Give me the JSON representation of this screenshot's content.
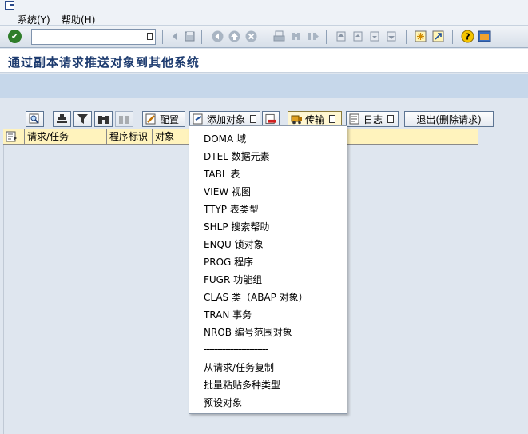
{
  "menubar": {
    "items": [
      {
        "label": "系统(Y)"
      },
      {
        "label": "帮助(H)"
      }
    ]
  },
  "toolbar": {
    "command_value": ""
  },
  "title": "通过副本请求推送对象到其他系统",
  "tree_toolbar": {
    "config_label": "配置",
    "add_object_label": "添加对象",
    "transport_label": "传输",
    "log_label": "日志",
    "exit_label": "退出(删除请求)"
  },
  "columns": [
    {
      "label": "请求/任务"
    },
    {
      "label": "程序标识"
    },
    {
      "label": "对象"
    }
  ],
  "dropdown": {
    "items": [
      {
        "label": "DOMA 域"
      },
      {
        "label": "DTEL 数据元素"
      },
      {
        "label": "TABL 表"
      },
      {
        "label": "VIEW 视图"
      },
      {
        "label": "TTYP 表类型"
      },
      {
        "label": "SHLP 搜索帮助"
      },
      {
        "label": "ENQU 锁对象"
      },
      {
        "label": "PROG 程序"
      },
      {
        "label": "FUGR 功能组"
      },
      {
        "label": "CLAS 类（ABAP 对象）"
      },
      {
        "label": "TRAN 事务"
      },
      {
        "label": "NROB 编号范围对象"
      }
    ],
    "separator": "------------------------",
    "extra_items": [
      {
        "label": "从请求/任务复制"
      },
      {
        "label": "批量粘贴多种类型"
      },
      {
        "label": "预设对象"
      }
    ]
  }
}
